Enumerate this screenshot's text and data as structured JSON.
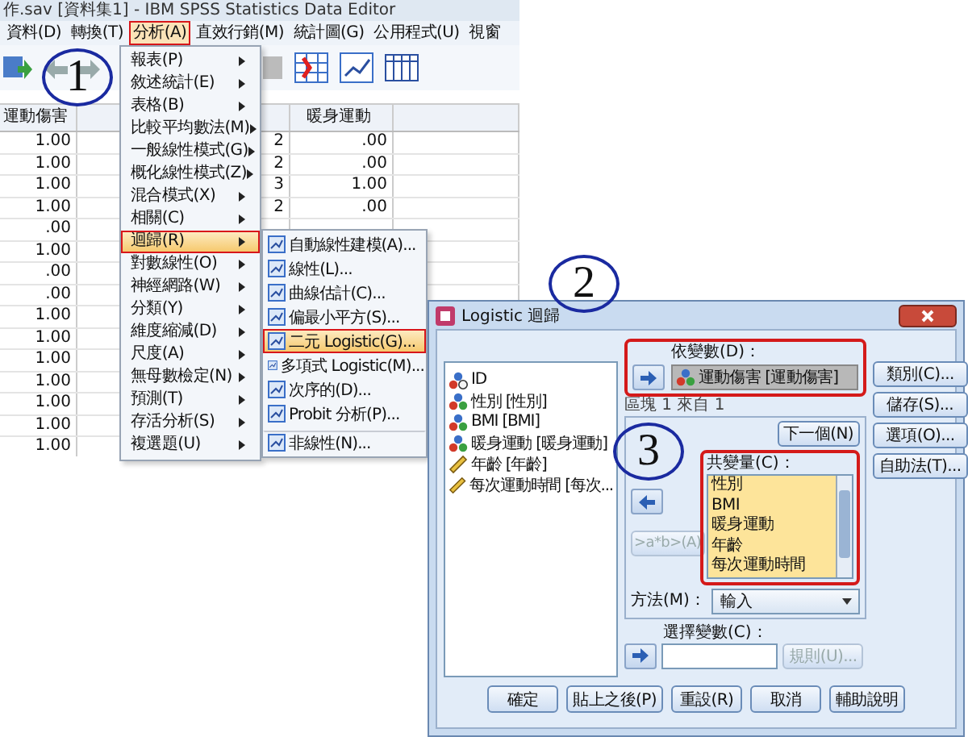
{
  "window": {
    "title": "作.sav [資料集1] - IBM SPSS Statistics Data Editor"
  },
  "menubar": [
    {
      "label": "資料(D)",
      "selected": false
    },
    {
      "label": "轉換(T)",
      "selected": false
    },
    {
      "label": "分析(A)",
      "selected": true
    },
    {
      "label": "直效行銷(M)",
      "selected": false
    },
    {
      "label": "統計圖(G)",
      "selected": false
    },
    {
      "label": "公用程式(U)",
      "selected": false
    },
    {
      "label": "視窗",
      "selected": false
    }
  ],
  "table": {
    "column_1": {
      "heading": "運動傷害",
      "cells": [
        "1.00",
        "1.00",
        "1.00",
        "1.00",
        ".00",
        "1.00",
        ".00",
        ".00",
        "1.00",
        "1.00",
        "1.00",
        "1.00",
        "1.00",
        "1.00",
        "1.00"
      ]
    },
    "column_3": {
      "cells": [
        "2",
        "2",
        "3",
        "2"
      ]
    },
    "column_4": {
      "heading": "暖身運動",
      "cells": [
        ".00",
        ".00",
        "1.00",
        ".00"
      ]
    }
  },
  "analyze_menu": {
    "items": [
      {
        "label": "報表(P)",
        "selected": false
      },
      {
        "label": "敘述統計(E)",
        "selected": false
      },
      {
        "label": "表格(B)",
        "selected": false
      },
      {
        "label": "比較平均數法(M)",
        "selected": false
      },
      {
        "label": "一般線性模式(G)",
        "selected": false
      },
      {
        "label": "概化線性模式(Z)",
        "selected": false
      },
      {
        "label": "混合模式(X)",
        "selected": false
      },
      {
        "label": "相關(C)",
        "selected": false
      },
      {
        "label": "迴歸(R)",
        "selected": true
      },
      {
        "label": "對數線性(O)",
        "selected": false
      },
      {
        "label": "神經網路(W)",
        "selected": false
      },
      {
        "label": "分類(Y)",
        "selected": false
      },
      {
        "label": "維度縮減(D)",
        "selected": false
      },
      {
        "label": "尺度(A)",
        "selected": false
      },
      {
        "label": "無母數檢定(N)",
        "selected": false
      },
      {
        "label": "預測(T)",
        "selected": false
      },
      {
        "label": "存活分析(S)",
        "selected": false
      },
      {
        "label": "複選題(U)",
        "selected": false
      }
    ]
  },
  "regression_submenu": {
    "items": [
      {
        "label": "自動線性建模(A)...",
        "selected": false,
        "divider_above": false
      },
      {
        "label": "線性(L)...",
        "selected": false,
        "divider_above": false
      },
      {
        "label": "曲線估計(C)...",
        "selected": false,
        "divider_above": false
      },
      {
        "label": "偏最小平方(S)...",
        "selected": false,
        "divider_above": false
      },
      {
        "label": "二元 Logistic(G)...",
        "selected": true,
        "divider_above": false
      },
      {
        "label": "多項式 Logistic(M)...",
        "selected": false,
        "divider_above": false
      },
      {
        "label": "次序的(D)...",
        "selected": false,
        "divider_above": false
      },
      {
        "label": "Probit 分析(P)...",
        "selected": false,
        "divider_above": false
      },
      {
        "label": "非線性(N)...",
        "selected": false,
        "divider_above": true
      }
    ]
  },
  "dialog": {
    "title": "Logistic 迴歸",
    "variables": [
      {
        "name": "ID",
        "kind": "string"
      },
      {
        "name": "性別 [性別]",
        "kind": "nominal"
      },
      {
        "name": "BMI [BMI]",
        "kind": "nominal"
      },
      {
        "name": "暖身運動 [暖身運動]",
        "kind": "nominal"
      },
      {
        "name": "年齡 [年齡]",
        "kind": "scale"
      },
      {
        "name": "每次運動時間 [每次...",
        "kind": "scale"
      }
    ],
    "dependent": {
      "label": "依變數(D)：",
      "value": "運動傷害 [運動傷害]"
    },
    "block": {
      "label": "區塊 1 來自 1",
      "next_button": "下一個(N)",
      "covariates_label": "共變量(C)：",
      "covariates": [
        "性別",
        "BMI",
        "暖身運動",
        "年齡",
        "每次運動時間"
      ],
      "interaction_button": {
        "label": ">a*b>(A)",
        "disabled": true
      },
      "method_label": "方法(M)：",
      "method": "輸入"
    },
    "selection": {
      "label": "選擇變數(C)：",
      "rule_button": {
        "label": "規則(U)...",
        "disabled": true
      }
    },
    "side_buttons": [
      "類別(C)...",
      "儲存(S)...",
      "選項(O)...",
      "自助法(T)..."
    ],
    "bottom_buttons": [
      "確定",
      "貼上之後(P)",
      "重設(R)",
      "取消",
      "輔助說明"
    ]
  },
  "annotations": [
    {
      "number": "1"
    },
    {
      "number": "2"
    },
    {
      "number": "3"
    }
  ]
}
